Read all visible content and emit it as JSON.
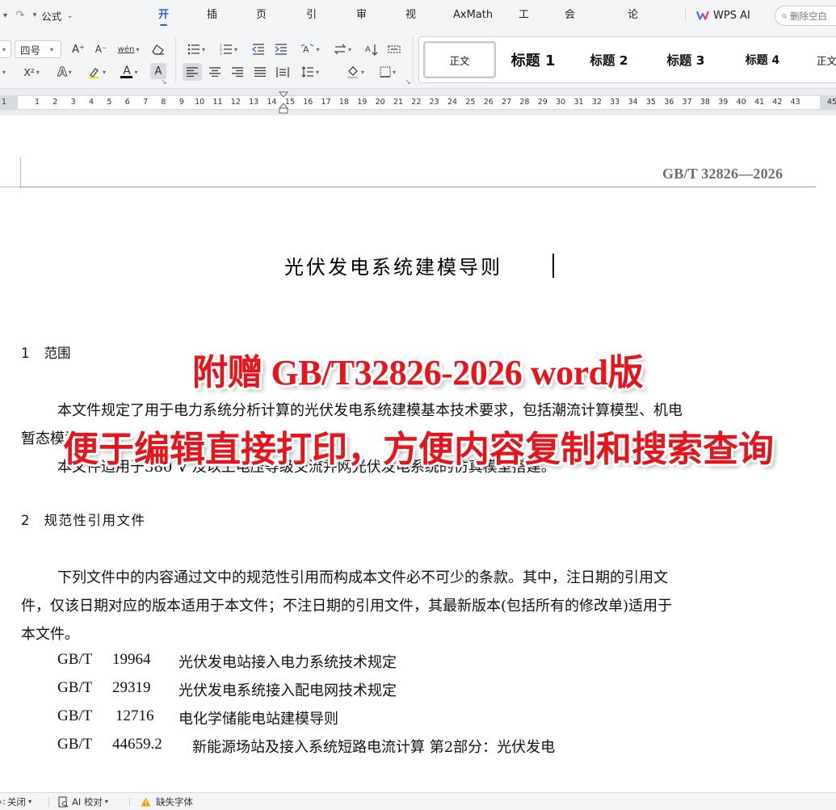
{
  "quick_access": {
    "redo_icon": "redo-icon",
    "formula_label": "公式"
  },
  "tabs": [
    {
      "label": "开始",
      "active": true
    },
    {
      "label": "插入"
    },
    {
      "label": "页面"
    },
    {
      "label": "引用"
    },
    {
      "label": "审阅"
    },
    {
      "label": "视图"
    },
    {
      "label": "AxMath"
    },
    {
      "label": "工具"
    },
    {
      "label": "会员专享"
    },
    {
      "label": "论文助手"
    }
  ],
  "wps_ai_label": "WPS AI",
  "search": {
    "placeholder": "删除空白"
  },
  "ribbon": {
    "font_size": "四号",
    "font_grow": "A⁺",
    "font_shrink": "A⁻",
    "pinyin": "wén",
    "superscript": "X²",
    "font_color_letter": "A",
    "char_shade_letter": "A"
  },
  "styles": [
    {
      "label": "正文",
      "selected": true
    },
    {
      "label": "标题 1"
    },
    {
      "label": "标题 2"
    },
    {
      "label": "标题 3"
    },
    {
      "label": "标题 4"
    },
    {
      "label": "正文"
    }
  ],
  "ruler": {
    "numbers": [
      "1",
      "1",
      "2",
      "3",
      "4",
      "5",
      "6",
      "7",
      "8",
      "9",
      "10",
      "11",
      "12",
      "13",
      "14",
      "15",
      "16",
      "17",
      "18",
      "19",
      "20",
      "21",
      "22",
      "23",
      "24",
      "25",
      "26",
      "27",
      "28",
      "29",
      "30",
      "31",
      "32",
      "33",
      "34",
      "35",
      "36",
      "37",
      "38",
      "39",
      "40",
      "41",
      "42",
      "43",
      "45"
    ]
  },
  "document": {
    "header_code": "GB/T 32826—2026",
    "title": "光伏发电系统建模导则",
    "section1": {
      "number": "1",
      "heading": "范围"
    },
    "para1_line1": "本文件规定了用于电力系统分析计算的光伏发电系统建模基本技术要求，包括潮流计算模型、机电",
    "para1_line2": "暂态模型。",
    "para2": "本文件适用于380 V 及以上电压等级交流并网光伏发电系统的仿真模型搭建。",
    "section2": {
      "number": "2",
      "heading": "规范性引用文件"
    },
    "para3_line1": "下列文件中的内容通过文中的规范性引用而构成本文件必不可少的条款。其中，注日期的引用文",
    "para3_line2": "件，仅该日期对应的版本适用于本文件；不注日期的引用文件，其最新版本(包括所有的修改单)适用于",
    "para3_line3": "本文件。",
    "references": [
      {
        "prefix": "GB/T",
        "number": "19964",
        "title": "光伏发电站接入电力系统技术规定"
      },
      {
        "prefix": "GB/T",
        "number": "29319",
        "title": "光伏发电系统接入配电网技术规定"
      },
      {
        "prefix": "GB/T",
        "number": "12716",
        "title": "电化学储能电站建模导则"
      },
      {
        "prefix": "GB/T",
        "number": "44659.2",
        "title": "新能源场站及接入系统短路电流计算  第2部分：光伏发电"
      }
    ]
  },
  "promo": {
    "line1": "附赠 GB/T32826-2026 word版",
    "line2": "便于编辑直接打印，方便内容复制和搜索查询",
    "color": "#e8141c"
  },
  "statusbar": {
    "item1": "关闭",
    "item2": "AI 校对",
    "item3": "缺失字体"
  },
  "colors": {
    "accent": "#2c62e8",
    "warning": "#f0a500"
  }
}
